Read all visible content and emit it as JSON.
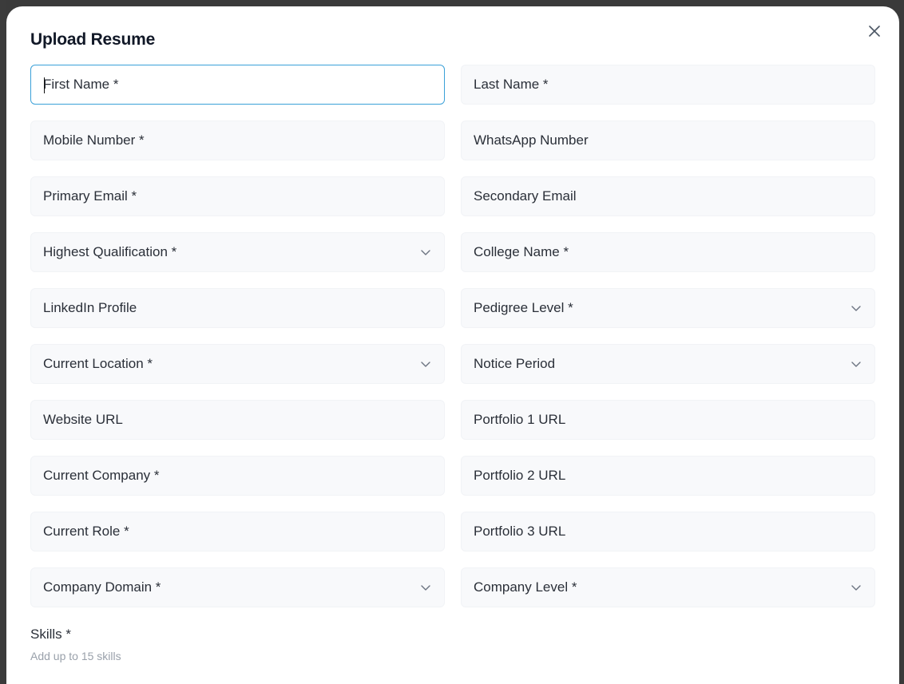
{
  "modal": {
    "title": "Upload Resume",
    "close_icon": "close-icon"
  },
  "fields": {
    "first_name": "First Name *",
    "last_name": "Last Name *",
    "mobile_number": "Mobile Number *",
    "whatsapp_number": "WhatsApp Number",
    "primary_email": "Primary Email *",
    "secondary_email": "Secondary Email",
    "highest_qualification": "Highest Qualification *",
    "college_name": "College Name *",
    "linkedin_profile": "LinkedIn Profile",
    "pedigree_level": "Pedigree Level *",
    "current_location": "Current Location *",
    "notice_period": "Notice Period",
    "website_url": "Website URL",
    "portfolio_1_url": "Portfolio 1 URL",
    "current_company": "Current Company *",
    "portfolio_2_url": "Portfolio 2 URL",
    "current_role": "Current Role *",
    "portfolio_3_url": "Portfolio 3 URL",
    "company_domain": "Company Domain *",
    "company_level": "Company Level *"
  },
  "skills": {
    "label": "Skills *",
    "hint": "Add up to 15 skills"
  },
  "colors": {
    "focus_border": "#3aa0d8",
    "field_bg": "#f8f9fb",
    "backdrop": "#3a3a3a"
  }
}
